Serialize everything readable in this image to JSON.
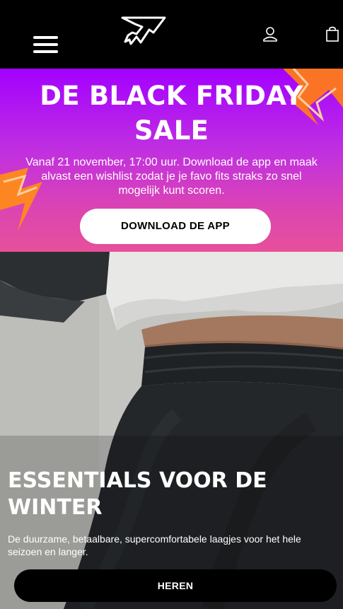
{
  "header": {
    "menu_icon": "hamburger-menu-icon",
    "logo": "gymshark-logo",
    "account_icon": "user-icon",
    "bag_icon": "shopping-bag-icon"
  },
  "promo": {
    "title_line1": "DE BLACK FRIDAY",
    "title_line2": "SALE",
    "text": "Vanaf 21 november, 17:00 uur. Download de app en maak alvast een wishlist zodat je je favo fits straks zo snel mogelijk kunt scoren.",
    "button_label": "DOWNLOAD DE APP",
    "colors": {
      "gradient_top": "#a300ff",
      "gradient_bottom": "#e6509a",
      "accent_orange": "#ff7a1a"
    }
  },
  "hero": {
    "title": "ESSENTIALS VOOR DE WINTER",
    "text": "De duurzame, betaalbare, supercomfortabele laagjes voor het hele seizoen en langer.",
    "button_label": "HEREN"
  }
}
